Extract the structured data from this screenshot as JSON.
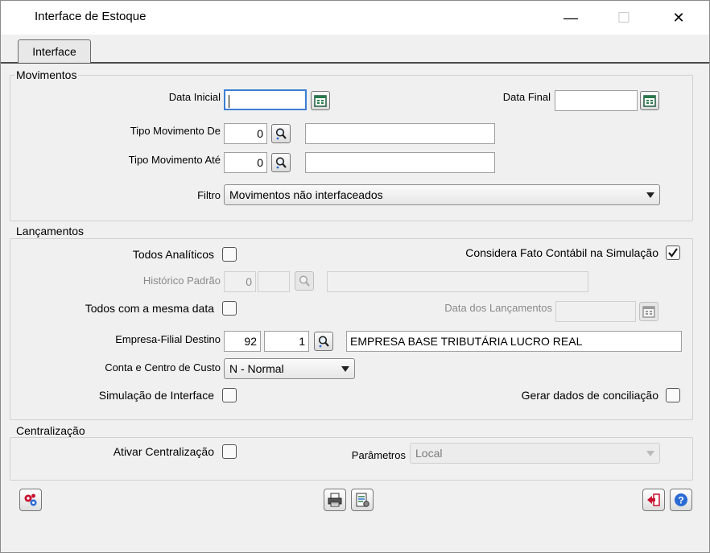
{
  "window": {
    "title": "Interface de Estoque",
    "minimize_glyph": "—",
    "maximize_glyph": "☐",
    "close_glyph": "✕"
  },
  "tabs": [
    {
      "label": "Interface",
      "selected": true
    }
  ],
  "movimentos": {
    "group_label": "Movimentos",
    "data_inicial": {
      "label": "Data Inicial",
      "value": ""
    },
    "data_final": {
      "label": "Data Final",
      "value": ""
    },
    "tipo_de": {
      "label": "Tipo Movimento De",
      "code": "0",
      "description": ""
    },
    "tipo_ate": {
      "label": "Tipo Movimento Até",
      "code": "0",
      "description": ""
    },
    "filtro": {
      "label": "Filtro",
      "value": "Movimentos não interfaceados"
    }
  },
  "lancamentos": {
    "group_label": "Lançamentos",
    "todos_analiticos": {
      "label": "Todos Analíticos",
      "checked": false
    },
    "considera_fato": {
      "label": "Considera Fato Contábil na Simulação",
      "checked": true
    },
    "historico_padrao": {
      "label": "Histórico Padrão",
      "code": "0",
      "code2": "",
      "description": "",
      "enabled": false
    },
    "todos_mesma_data": {
      "label": "Todos com a mesma data",
      "checked": false
    },
    "data_lancamentos": {
      "label": "Data dos Lançamentos",
      "value": "",
      "enabled": false
    },
    "empresa_filial": {
      "label": "Empresa-Filial Destino",
      "empresa": "92",
      "filial": "1",
      "description": "EMPRESA BASE TRIBUTÁRIA LUCRO REAL"
    },
    "conta_centro": {
      "label": "Conta e Centro de Custo",
      "value": "N - Normal"
    },
    "simulacao": {
      "label": "Simulação de Interface",
      "checked": false
    },
    "gerar_dados": {
      "label": "Gerar dados de conciliação",
      "checked": false
    }
  },
  "centralizacao": {
    "group_label": "Centralização",
    "ativar": {
      "label": "Ativar Centralização",
      "checked": false
    },
    "parametros": {
      "label": "Parâmetros",
      "value": "Local",
      "enabled": false
    }
  },
  "toolbar": {
    "icons": [
      "gears-icon",
      "printer-icon",
      "report-config-icon",
      "exit-icon",
      "help-icon"
    ]
  },
  "colors": {
    "accent_red": "#c8102e",
    "accent_blue": "#2b6cd4",
    "focus_border": "#3c7fd4",
    "check_color": "#1a1a1a"
  }
}
